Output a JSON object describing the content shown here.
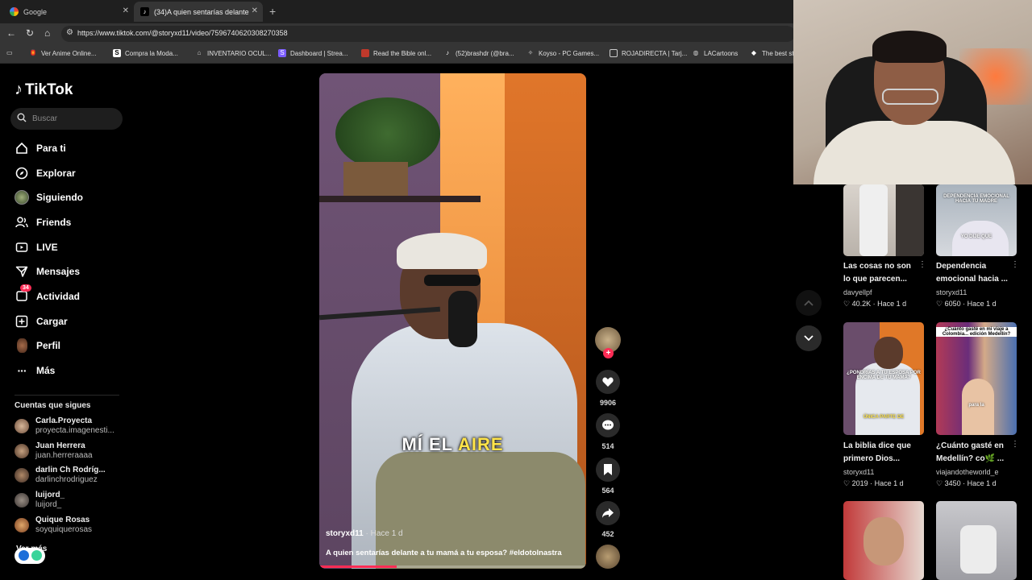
{
  "browser": {
    "tabs": [
      {
        "title": "Google",
        "active": false
      },
      {
        "title": "(34)A quien sentarías delante a tu",
        "active": true
      }
    ],
    "url": "https://www.tiktok.com/@storyxd11/video/7596740620308270358",
    "bookmarks": [
      "Ver Anime Online...",
      "Compra la Moda...",
      "INVENTARIO OCUL...",
      "Dashboard | Strea...",
      "Read the Bible onl...",
      "(52)brashdr (@bra...",
      "Koyso - PC Games...",
      "ROJADIRECTA | Tarj...",
      "LACartoons",
      "The best st"
    ]
  },
  "sidebar": {
    "brand": "TikTok",
    "search_placeholder": "Buscar",
    "nav": [
      {
        "label": "Para ti",
        "icon": "home-icon"
      },
      {
        "label": "Explorar",
        "icon": "compass-icon"
      },
      {
        "label": "Siguiendo",
        "icon": "following-avatar-icon"
      },
      {
        "label": "Friends",
        "icon": "friends-icon"
      },
      {
        "label": "LIVE",
        "icon": "live-icon"
      },
      {
        "label": "Mensajes",
        "icon": "inbox-icon"
      },
      {
        "label": "Actividad",
        "icon": "activity-icon",
        "badge": "34"
      },
      {
        "label": "Cargar",
        "icon": "upload-icon"
      },
      {
        "label": "Perfil",
        "icon": "profile-avatar-icon"
      },
      {
        "label": "Más",
        "icon": "more-icon"
      }
    ],
    "following_title": "Cuentas que sigues",
    "following": [
      {
        "name": "Carla.Proyecta",
        "username": "proyecta.imagenesti..."
      },
      {
        "name": "Juan Herrera",
        "username": "juan.herreraaaa"
      },
      {
        "name": "darlin Ch Rodríg...",
        "username": "darlinchrodriguez"
      },
      {
        "name": "luijord_",
        "username": "luijord_"
      },
      {
        "name": "Quique Rosas",
        "username": "soyquiquerosas"
      }
    ],
    "see_more": "Ver más"
  },
  "video": {
    "caption_white": "MÍ EL",
    "caption_yellow": "AIRE",
    "author": "storyxd11",
    "time": "· Hace 1 d",
    "description": "A quien sentarías delante a tu mamá a tu esposa? #eldotolnastra",
    "progress": 0.29
  },
  "actions": {
    "likes": "9906",
    "comments": "514",
    "saves": "564",
    "shares": "452"
  },
  "suggestions": [
    {
      "title1": "Las cosas no son",
      "title2": "lo que parecen...",
      "user": "davyellpf",
      "likes": "40.2K",
      "time": "Hace 1 d",
      "overlay": ""
    },
    {
      "title1": "Dependencia",
      "title2": "emocional hacia ...",
      "user": "storyxd11",
      "likes": "6050",
      "time": "Hace 1 d",
      "overlay": "DEPENDENCIA EMOCIONAL HACIA TU MADRE"
    },
    {
      "title1": "La biblia dice que",
      "title2": "primero Dios...",
      "user": "storyxd11",
      "likes": "2019",
      "time": "Hace 1 d",
      "overlay": "ÚNICA PARTE DE"
    },
    {
      "title1": "¿Cuánto gasté en",
      "title2": "Medellín? co🌿 ...",
      "user": "viajandotheworld_e",
      "likes": "3450",
      "time": "Hace 1 d",
      "overlay": "¿Cuánto gasté en mi viaje a Colombia... edición Medellín?"
    },
    {
      "title1": "",
      "title2": "",
      "user": "",
      "likes": "",
      "time": "",
      "overlay": ""
    },
    {
      "title1": "",
      "title2": "",
      "user": "",
      "likes": "",
      "time": "",
      "overlay": ""
    }
  ],
  "colors": {
    "accent": "#fe2c55",
    "caption_highlight": "#ffe44a"
  }
}
